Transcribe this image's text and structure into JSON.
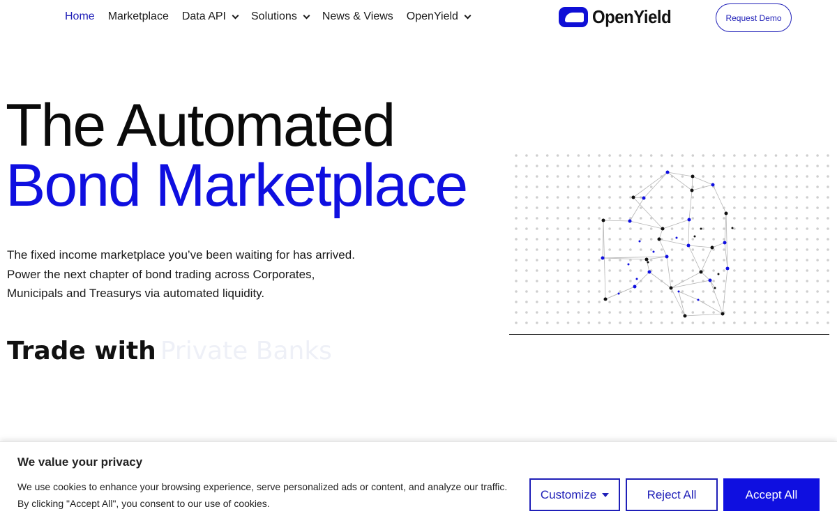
{
  "nav": {
    "items": [
      {
        "label": "Home",
        "active": true,
        "dropdown": false
      },
      {
        "label": "Marketplace",
        "active": false,
        "dropdown": false
      },
      {
        "label": "Data API",
        "active": false,
        "dropdown": true
      },
      {
        "label": "Solutions",
        "active": false,
        "dropdown": true
      },
      {
        "label": "News & Views",
        "active": false,
        "dropdown": false
      },
      {
        "label": "OpenYield",
        "active": false,
        "dropdown": true
      }
    ],
    "logo_text": "OpenYield",
    "demo_label": "Request Demo"
  },
  "hero": {
    "line1": "The Automated",
    "line2": "Bond Marketplace",
    "desc": [
      "The fixed income marketplace you’ve been waiting for has arrived.",
      "Power the next chapter of bond trading across Corporates,",
      "Municipals and Treasurys via automated liquidity."
    ],
    "trade_prefix": "Trade with",
    "trade_rotating": "Private Banks"
  },
  "graphic": {
    "icon": "network-graph-icon",
    "colors": {
      "dot_grid": "#cfcfcf",
      "node_blue": "#0f0fe0",
      "node_black": "#111111",
      "edge": "#b5b5b5"
    }
  },
  "cookie": {
    "title": "We value your privacy",
    "text": [
      "We use cookies to enhance your browsing experience, serve personalized ads or content, and analyze our traffic.",
      "By clicking \"Accept All\", you consent to our use of cookies."
    ],
    "customize_label": "Customize",
    "reject_label": "Reject All",
    "accept_label": "Accept All"
  },
  "colors": {
    "accent": "#0f0fe0",
    "nav_active": "#1f1fb8",
    "text": "#111111"
  }
}
